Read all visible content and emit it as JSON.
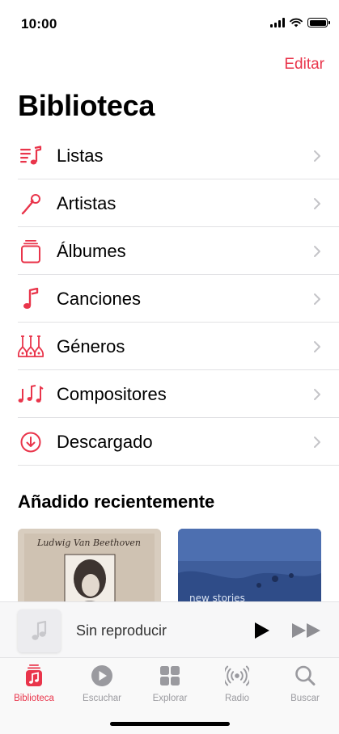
{
  "status_bar": {
    "time": "10:00"
  },
  "header": {
    "edit_label": "Editar",
    "title": "Biblioteca"
  },
  "library": {
    "items": [
      {
        "label": "Listas",
        "icon": "playlist-icon"
      },
      {
        "label": "Artistas",
        "icon": "microphone-icon"
      },
      {
        "label": "Álbumes",
        "icon": "album-stack-icon"
      },
      {
        "label": "Canciones",
        "icon": "music-note-icon"
      },
      {
        "label": "Géneros",
        "icon": "guitars-icon"
      },
      {
        "label": "Compositores",
        "icon": "music-notes-icon"
      },
      {
        "label": "Descargado",
        "icon": "download-circle-icon"
      }
    ]
  },
  "recent": {
    "title": "Añadido recientemente",
    "albums": [
      {
        "cover_text": "Ludwig Van Beethoven"
      },
      {
        "cover_text": "new stories"
      }
    ]
  },
  "mini_player": {
    "title": "Sin reproducir"
  },
  "tab_bar": {
    "tabs": [
      {
        "label": "Biblioteca",
        "icon": "library-icon",
        "active": true
      },
      {
        "label": "Escuchar",
        "icon": "play-circle-icon",
        "active": false
      },
      {
        "label": "Explorar",
        "icon": "grid-icon",
        "active": false
      },
      {
        "label": "Radio",
        "icon": "radio-icon",
        "active": false
      },
      {
        "label": "Buscar",
        "icon": "search-icon",
        "active": false
      }
    ]
  },
  "colors": {
    "accent": "#e9354b",
    "divider": "#e1e1e4",
    "tab_inactive": "#9a9a9f"
  }
}
